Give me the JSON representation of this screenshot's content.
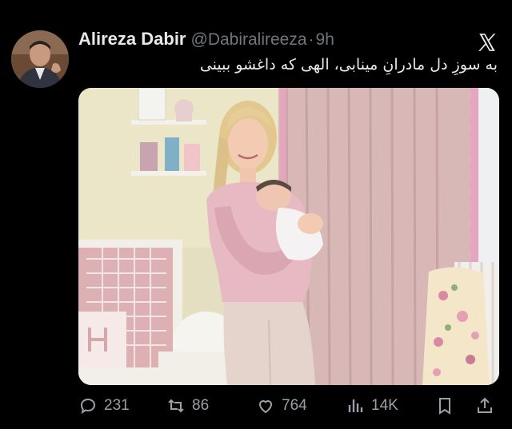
{
  "tweet": {
    "author_name": "Alireza Dabir",
    "handle": "@Dabiralireeza",
    "separator": "·",
    "time": "9h",
    "text": "به سوزِ دل مادرانِ مینابی، الهی که داغشو ببینی",
    "media": {
      "description_icon": "photo"
    }
  },
  "icons": {
    "app": "x-logo-icon",
    "reply": "reply-icon",
    "repost": "repost-icon",
    "like": "like-icon",
    "views": "views-icon",
    "bookmark": "bookmark-icon",
    "share": "share-icon"
  },
  "actions": {
    "replies": "231",
    "reposts": "86",
    "likes": "764",
    "views": "14K"
  },
  "colors": {
    "background": "#000000",
    "text": "#e7e9ea",
    "secondary": "#71767b",
    "icon": "#9aa0a6"
  }
}
